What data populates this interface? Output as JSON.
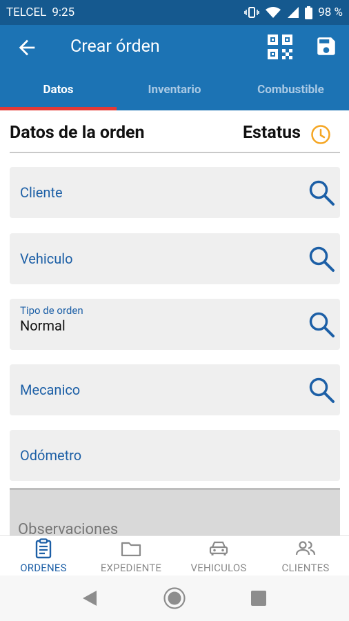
{
  "statusbar": {
    "carrier": "TELCEL",
    "time": "9:25",
    "battery": "98 %"
  },
  "appbar": {
    "title": "Crear órden"
  },
  "tabs": [
    "Datos",
    "Inventario",
    "Combustible"
  ],
  "section": {
    "title": "Datos de la orden",
    "status_label": "Estatus"
  },
  "fields": {
    "cliente": {
      "label": "Cliente"
    },
    "vehiculo": {
      "label": "Vehiculo"
    },
    "tipo": {
      "label": "Tipo de orden",
      "value": "Normal"
    },
    "mecanico": {
      "label": "Mecanico"
    },
    "odometro": {
      "label": "Odómetro"
    },
    "observaciones": {
      "label": "Observaciones"
    }
  },
  "bottom_nav": [
    {
      "label": "ORDENES",
      "icon": "clipboard-icon"
    },
    {
      "label": "EXPEDIENTE",
      "icon": "folder-icon"
    },
    {
      "label": "VEHICULOS",
      "icon": "car-icon"
    },
    {
      "label": "CLIENTES",
      "icon": "people-icon"
    }
  ],
  "colors": {
    "primary": "#1c73b4",
    "status_bar": "#15598f",
    "accent": "#e53935",
    "clock": "#f5a623",
    "link": "#1c5fa6"
  }
}
